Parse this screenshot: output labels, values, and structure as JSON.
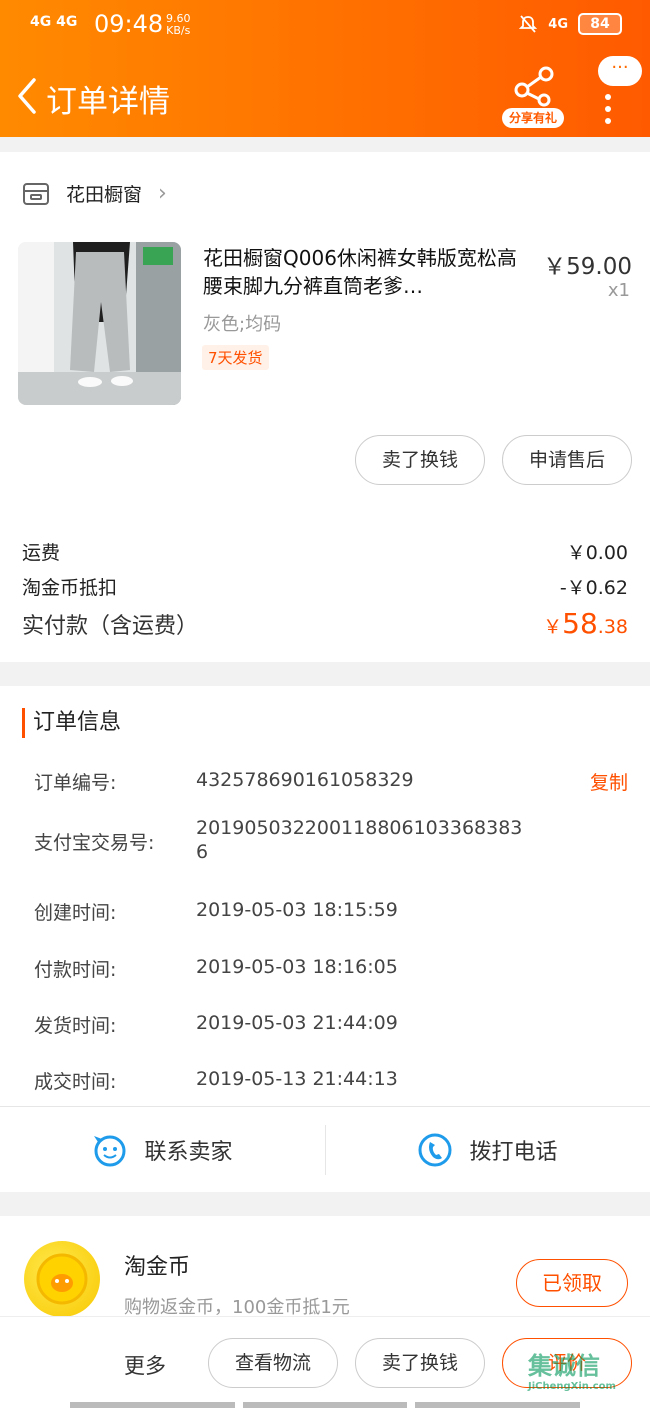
{
  "status_bar": {
    "signal": "4G 4G",
    "time": "09:48",
    "speed_value": "9.60",
    "speed_unit": "KB/s",
    "network": "4G",
    "battery": "84"
  },
  "nav": {
    "title": "订单详情",
    "share_label": "分享有礼",
    "more_bubble": "···"
  },
  "shop": {
    "name": "花田橱窗"
  },
  "product": {
    "title": "花田橱窗Q006休闲裤女韩版宽松高腰束脚九分裤直筒老爹…",
    "price": "￥59.00",
    "qty": "x1",
    "sku": "灰色;均码",
    "tag": "7天发货",
    "actions": [
      "卖了换钱",
      "申请售后"
    ]
  },
  "fees": {
    "shipping_label": "运费",
    "shipping_value": "￥0.00",
    "coin_label": "淘金币抵扣",
    "coin_value": "-￥0.62",
    "paid_label": "实付款（含运费）",
    "paid_currency": "￥",
    "paid_int": "58",
    "paid_dec": ".38"
  },
  "order_info": {
    "title": "订单信息",
    "copy_label": "复制",
    "rows": [
      {
        "label": "订单编号:",
        "value": "432578690161058329"
      },
      {
        "label": "支付宝交易号:",
        "value": "2019050322001188061033683836"
      },
      {
        "label": "创建时间:",
        "value": "2019-05-03 18:15:59"
      },
      {
        "label": "付款时间:",
        "value": "2019-05-03 18:16:05"
      },
      {
        "label": "发货时间:",
        "value": "2019-05-03 21:44:09"
      },
      {
        "label": "成交时间:",
        "value": "2019-05-13 21:44:13"
      }
    ]
  },
  "contact": {
    "seller": "联系卖家",
    "phone": "拨打电话"
  },
  "coins": {
    "title": "淘金币",
    "subtitle": "购物返金币，100金币抵1元",
    "button": "已领取"
  },
  "bottom_bar": {
    "more": "更多",
    "buttons": [
      "查看物流",
      "卖了换钱",
      "评价"
    ]
  },
  "watermark": {
    "text": "集诚信",
    "url": "JiChengXin.com"
  },
  "colors": {
    "accent": "#ff5000",
    "header_start": "#ff8a00",
    "header_end": "#ff5a00"
  }
}
